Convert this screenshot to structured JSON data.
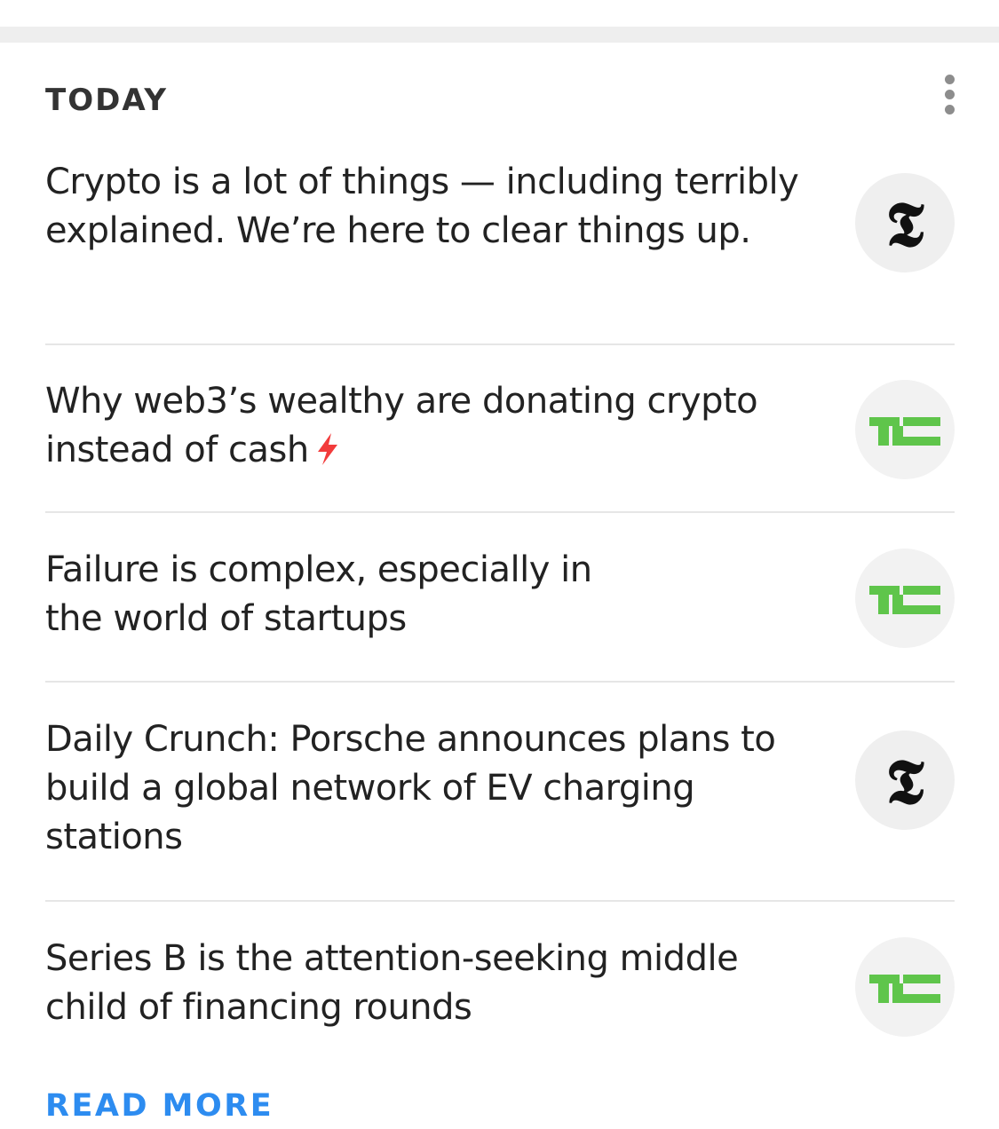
{
  "section": {
    "title": "TODAY",
    "menu_icon": "more-vertical-icon"
  },
  "news": [
    {
      "headline": "Crypto is a lot of things — including terribly explained. We’re here to clear things up.",
      "source_icon": "nyt-logo-icon",
      "flash": false
    },
    {
      "headline": "Why web3’s wealthy are donating crypto instead of cash",
      "source_icon": "techcrunch-logo-icon",
      "flash": true
    },
    {
      "headline": "Failure is complex, especially in the world of startups",
      "source_icon": "techcrunch-logo-icon",
      "flash": false
    },
    {
      "headline": "Daily Crunch: Porsche announces plans to build a global network of EV charging stations",
      "source_icon": "nyt-logo-icon",
      "flash": false
    },
    {
      "headline": "Series B is the attention-seeking middle child of financing rounds",
      "source_icon": "techcrunch-logo-icon",
      "flash": false
    }
  ],
  "footer": {
    "read_more_label": "READ MORE"
  },
  "colors": {
    "accent": "#2d8cf0",
    "techcrunch_green": "#5fc54b",
    "flash_red": "#f23b3b",
    "text": "#222222"
  }
}
